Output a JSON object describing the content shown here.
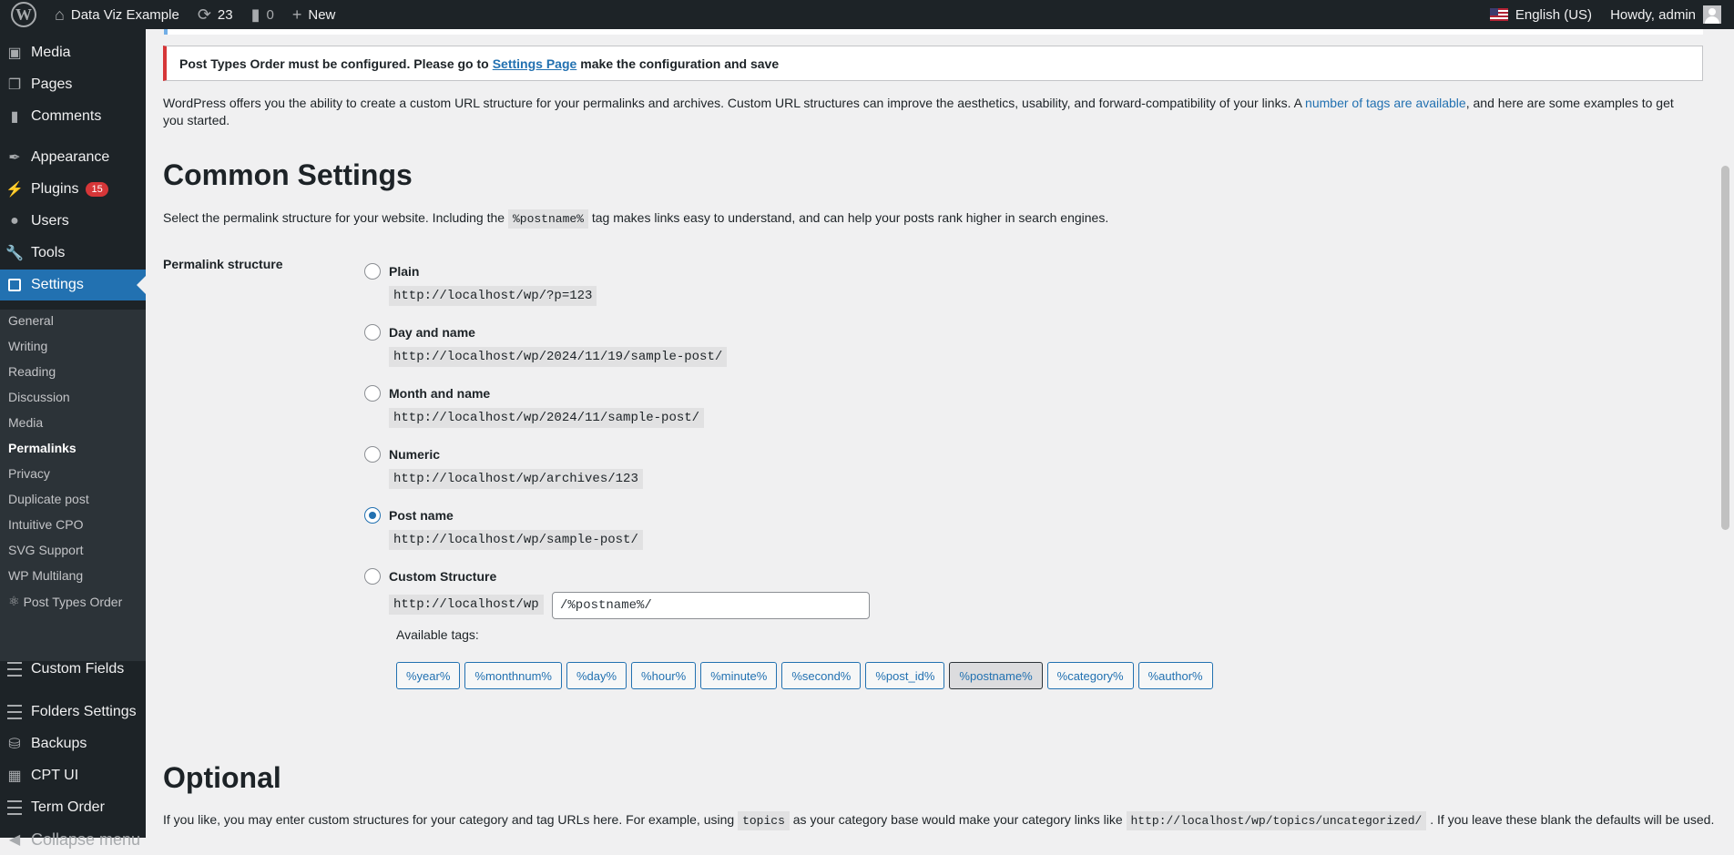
{
  "adminbar": {
    "site_name": "Data Viz Example",
    "updates_count": "23",
    "comments_count": "0",
    "new_label": "New",
    "language": "English (US)",
    "howdy": "Howdy, admin"
  },
  "sidebar": {
    "items": [
      {
        "label": "Media"
      },
      {
        "label": "Pages"
      },
      {
        "label": "Comments"
      },
      {
        "label": "Appearance"
      },
      {
        "label": "Plugins",
        "badge": "15"
      },
      {
        "label": "Users"
      },
      {
        "label": "Tools"
      },
      {
        "label": "Settings"
      },
      {
        "label": "Custom Fields"
      },
      {
        "label": "Folders Settings"
      },
      {
        "label": "Backups"
      },
      {
        "label": "CPT UI"
      },
      {
        "label": "Term Order"
      },
      {
        "label": "Collapse menu"
      }
    ],
    "submenu": [
      "General",
      "Writing",
      "Reading",
      "Discussion",
      "Media",
      "Permalinks",
      "Privacy",
      "Duplicate post",
      "Intuitive CPO",
      "SVG Support",
      "WP Multilang",
      "Post Types Order"
    ]
  },
  "notice": {
    "before": "Post Types Order must be configured. Please go to",
    "link": "Settings Page",
    "after": "make the configuration and save"
  },
  "intro": {
    "text1": "WordPress offers you the ability to create a custom URL structure for your permalinks and archives. Custom URL structures can improve the aesthetics, usability, and forward-compatibility of your links. A ",
    "link": "number of tags are available",
    "text2": ", and here are some examples to get you started."
  },
  "common": {
    "heading": "Common Settings",
    "desc_before": "Select the permalink structure for your website. Including the",
    "desc_code": "%postname%",
    "desc_after": "tag makes links easy to understand, and can help your posts rank higher in search engines.",
    "field_label": "Permalink structure",
    "options": [
      {
        "label": "Plain",
        "sample": "http://localhost/wp/?p=123",
        "checked": false
      },
      {
        "label": "Day and name",
        "sample": "http://localhost/wp/2024/11/19/sample-post/",
        "checked": false
      },
      {
        "label": "Month and name",
        "sample": "http://localhost/wp/2024/11/sample-post/",
        "checked": false
      },
      {
        "label": "Numeric",
        "sample": "http://localhost/wp/archives/123",
        "checked": false
      },
      {
        "label": "Post name",
        "sample": "http://localhost/wp/sample-post/",
        "checked": true
      },
      {
        "label": "Custom Structure",
        "sample": "http://localhost/wp",
        "checked": false
      }
    ],
    "custom_value": "/%postname%/",
    "available_tags_label": "Available tags:",
    "tags": [
      "%year%",
      "%monthnum%",
      "%day%",
      "%hour%",
      "%minute%",
      "%second%",
      "%post_id%",
      "%postname%",
      "%category%",
      "%author%"
    ],
    "active_tag": "%postname%"
  },
  "optional": {
    "heading": "Optional",
    "desc_before": "If you like, you may enter custom structures for your category and tag URLs here. For example, using",
    "desc_code1": "topics",
    "desc_mid": "as your category base would make your category links like",
    "desc_code2": "http://localhost/wp/topics/uncategorized/",
    "desc_after": ". If you leave these blank the defaults will be used."
  },
  "colors": {
    "accent": "#2271b1",
    "adminbar": "#1d2327",
    "notice_error": "#d63638"
  }
}
